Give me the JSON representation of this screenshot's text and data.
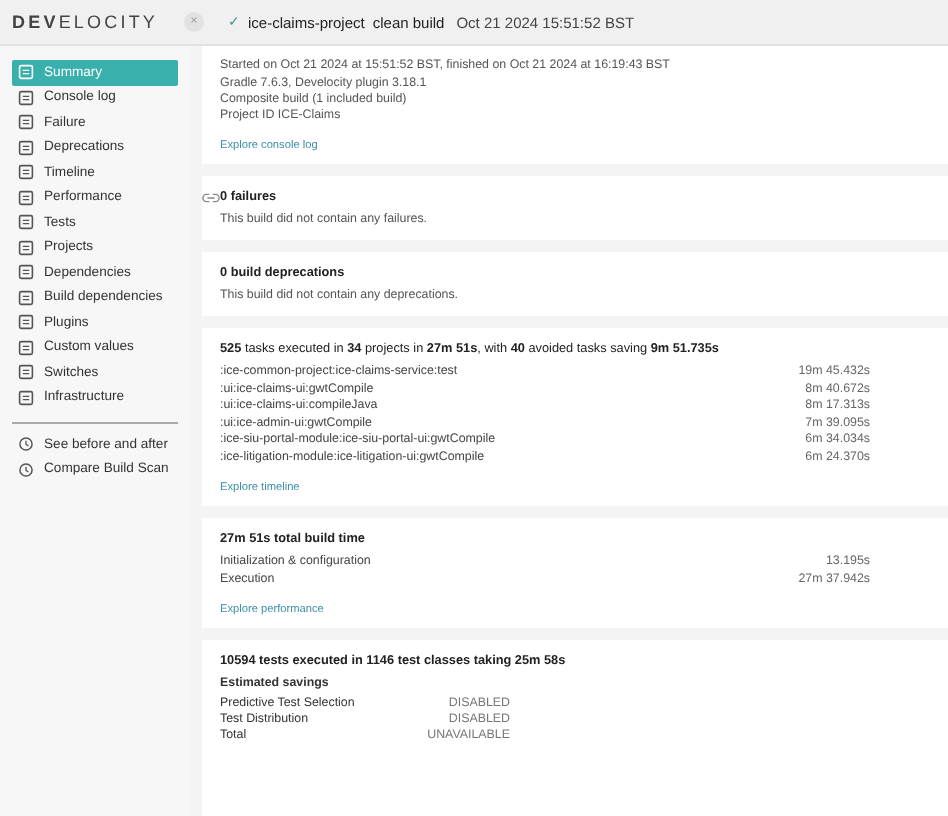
{
  "logo": "**DEV**ELOCITY",
  "header": {
    "close": "×",
    "status": "✓",
    "project": "ice-claims-project",
    "tasks": "clean build",
    "date": "Oct 21 2024 15:51:52 BST"
  },
  "sidebar": {
    "items": [
      {
        "label": "Summary",
        "selected": true
      },
      {
        "label": "Console log",
        "selected": false
      },
      {
        "label": "Failure",
        "selected": false
      },
      {
        "label": "Deprecations",
        "selected": false
      },
      {
        "label": "Timeline",
        "selected": false
      },
      {
        "label": "Performance",
        "selected": false
      },
      {
        "label": "Tests",
        "selected": false
      },
      {
        "label": "Projects",
        "selected": false
      },
      {
        "label": "Dependencies",
        "selected": false
      },
      {
        "label": "Build dependencies",
        "selected": false
      },
      {
        "label": "Plugins",
        "selected": false
      },
      {
        "label": "Custom values",
        "selected": false
      },
      {
        "label": "Switches",
        "selected": false
      },
      {
        "label": "Infrastructure",
        "selected": false
      }
    ],
    "actions": [
      "See before and after",
      "Compare Build Scan"
    ]
  },
  "overview": {
    "lines": [
      "Started on Oct 21 2024 at 15:51:52 BST, finished on Oct 21 2024 at 16:19:43 BST",
      "Gradle 7.6.3,  Develocity plugin 3.18.1",
      "Composite build (1 included build)",
      "Project ID ICE-Claims"
    ],
    "link": "Explore console log"
  },
  "failures": {
    "title": "0 failures",
    "text": "This build did not contain any failures."
  },
  "deprecations": {
    "title": "0 build deprecations",
    "text": "This build did not contain any deprecations."
  },
  "tasks": {
    "title": "**525** tasks executed in **34** projects in **27m 51s**, with **40** avoided tasks saving **9m 51.735s**",
    "rows": [
      {
        "name": ":ice-common-project:ice-claims-service:test",
        "time": "19m 45.432s"
      },
      {
        "name": ":ui:ice-claims-ui:gwtCompile",
        "time": "8m 40.672s"
      },
      {
        "name": ":ui:ice-claims-ui:compileJava",
        "time": "8m 17.313s"
      },
      {
        "name": ":ui:ice-admin-ui:gwtCompile",
        "time": "7m 39.095s"
      },
      {
        "name": ":ice-siu-portal-module:ice-siu-portal-ui:gwtCompile",
        "time": "6m 34.034s"
      },
      {
        "name": ":ice-litigation-module:ice-litigation-ui:gwtCompile",
        "time": "6m 24.370s"
      }
    ],
    "link": "Explore timeline"
  },
  "performance": {
    "title": "27m 51s total build time",
    "rows": [
      {
        "name": "Initialization & configuration",
        "time": "13.195s"
      },
      {
        "name": "Execution",
        "time": "27m 37.942s"
      }
    ],
    "link": "Explore performance"
  },
  "tests": {
    "title": "10594 tests executed in 1146 test classes taking 25m 58s",
    "subtitle": "Estimated savings",
    "rows": [
      {
        "name": "Predictive Test Selection",
        "value": "DISABLED"
      },
      {
        "name": "Test Distribution",
        "value": "DISABLED"
      },
      {
        "name": "Total",
        "value": "UNAVAILABLE"
      }
    ]
  }
}
